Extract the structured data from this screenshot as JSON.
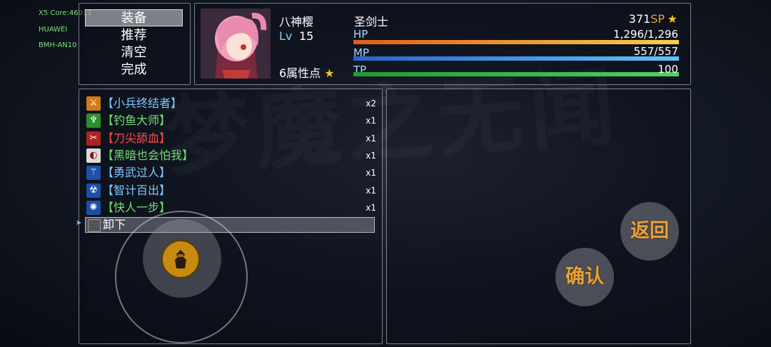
{
  "debug": [
    "X5 Core:46011",
    "HUAWEI",
    "BMH-AN10"
  ],
  "background_text": "梦魔之无闻",
  "command_menu": {
    "items": [
      {
        "label": "装备",
        "selected": true
      },
      {
        "label": "推荐",
        "selected": false
      },
      {
        "label": "清空",
        "selected": false
      },
      {
        "label": "完成",
        "selected": false
      }
    ]
  },
  "actor": {
    "name": "八神樱",
    "level_label": "Lv",
    "level": "15",
    "class": "圣剑士",
    "sp": "371",
    "sp_label": "SP",
    "attribute_points": "6属性点",
    "hp_label": "HP",
    "hp_text": "1,296/1,296",
    "hp_fraction": 1.0,
    "mp_label": "MP",
    "mp_text": "557/557",
    "mp_fraction": 1.0,
    "tp_label": "TP",
    "tp_text": "100",
    "tp_fraction": 1.0,
    "colors": {
      "hp_gradient": [
        "#e05c1c",
        "#f7d04a"
      ],
      "mp_gradient": [
        "#2a63c9",
        "#5fc3f5"
      ],
      "tp_gradient": [
        "#1e9b36",
        "#4cd45f"
      ]
    }
  },
  "skills": [
    {
      "name": "【小兵终结者】",
      "count": "x2",
      "color": "#7fc8ff",
      "icon": "running-man-icon",
      "icon_bg": "#d27a1a",
      "icon_glyph": "⚔"
    },
    {
      "name": "【钓鱼大师】",
      "count": "x1",
      "color": "#6fe06f",
      "icon": "fishing-rod-icon",
      "icon_bg": "#2d8f2d",
      "icon_glyph": "♆"
    },
    {
      "name": "【刀尖舔血】",
      "count": "x1",
      "color": "#ff4a4a",
      "icon": "bleeding-blade-icon",
      "icon_bg": "#b02222",
      "icon_glyph": "✂"
    },
    {
      "name": "【黑暗也会怕我】",
      "count": "x1",
      "color": "#6fe06f",
      "icon": "dark-shield-icon",
      "icon_bg": "#dcdcdc",
      "icon_glyph": "◐"
    },
    {
      "name": "【勇武过人】",
      "count": "x1",
      "color": "#7fc8ff",
      "icon": "sword-slash-icon",
      "icon_bg": "#1c4fa8",
      "icon_glyph": "⚚"
    },
    {
      "name": "【智计百出】",
      "count": "x1",
      "color": "#7fc8ff",
      "icon": "radiation-icon",
      "icon_bg": "#1c4fa8",
      "icon_glyph": "☢"
    },
    {
      "name": "【快人一步】",
      "count": "x1",
      "color": "#6fe06f",
      "icon": "burst-icon",
      "icon_bg": "#1c4fa8",
      "icon_glyph": "✺"
    }
  ],
  "unequip_label": "卸下",
  "buttons": {
    "back": "返回",
    "confirm": "确认"
  }
}
